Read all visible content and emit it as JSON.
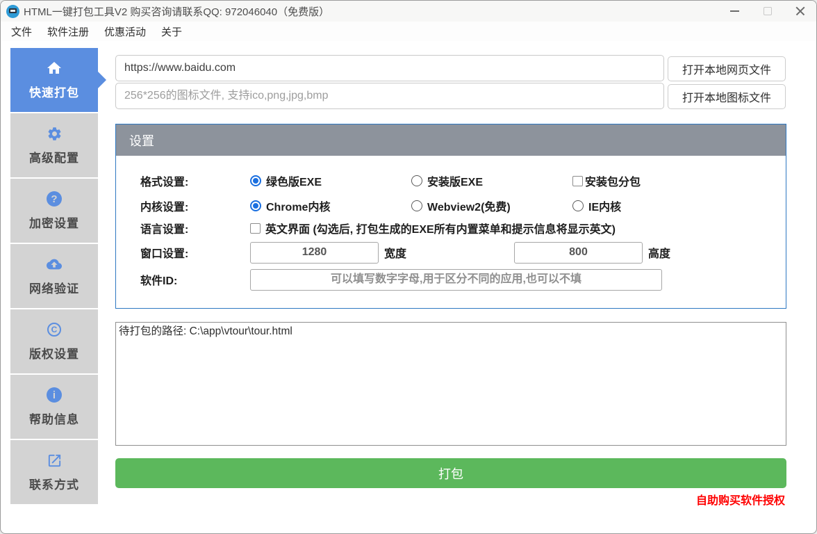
{
  "window": {
    "title": "HTML一键打包工具V2 购买咨询请联系QQ: 972046040（免费版）"
  },
  "menu": {
    "items": [
      {
        "label": "文件"
      },
      {
        "label": "软件注册"
      },
      {
        "label": "优惠活动"
      },
      {
        "label": "关于"
      }
    ]
  },
  "sidebar": {
    "items": [
      {
        "label": "快速打包",
        "icon": "home-icon",
        "active": true
      },
      {
        "label": "高级配置",
        "icon": "gear-icon",
        "active": false
      },
      {
        "label": "加密设置",
        "icon": "question-icon",
        "active": false
      },
      {
        "label": "网络验证",
        "icon": "cloud-upload-icon",
        "active": false
      },
      {
        "label": "版权设置",
        "icon": "copyright-icon",
        "active": false
      },
      {
        "label": "帮助信息",
        "icon": "info-icon",
        "active": false
      },
      {
        "label": "联系方式",
        "icon": "external-link-icon",
        "active": false
      }
    ]
  },
  "main": {
    "url_input": {
      "value": "https://www.baidu.com"
    },
    "icon_input": {
      "placeholder": "256*256的图标文件, 支持ico,png,jpg,bmp"
    },
    "open_html_button": "打开本地网页文件",
    "open_icon_button": "打开本地图标文件",
    "settings": {
      "title": "设置",
      "format": {
        "label": "格式设置:",
        "opt1": "绿色版EXE",
        "opt2": "安装版EXE",
        "opt3": "安装包分包",
        "selected": "绿色版EXE"
      },
      "kernel": {
        "label": "内核设置:",
        "opt1": "Chrome内核",
        "opt2": "Webview2(免费)",
        "opt3": "IE内核",
        "selected": "Chrome内核"
      },
      "language": {
        "label": "语言设置:",
        "opt1": "英文界面 (勾选后, 打包生成的EXE所有内置菜单和提示信息将显示英文)",
        "checked": false
      },
      "window_size": {
        "label": "窗口设置:",
        "width": "1280",
        "width_unit": "宽度",
        "height": "800",
        "height_unit": "高度"
      },
      "app_id": {
        "label": "软件ID:",
        "placeholder": "可以填写数字字母,用于区分不同的应用,也可以不填"
      }
    },
    "log": {
      "text": "待打包的路径: C:\\app\\vtour\\tour.html"
    },
    "package_button": "打包",
    "buy_link": "自助购买软件授权"
  },
  "colors": {
    "accent_blue": "#5b8ee0",
    "panel_border_blue": "#2d78c2",
    "header_gray": "#8d939c",
    "button_green": "#5cb85c",
    "link_red": "#ff0000"
  }
}
